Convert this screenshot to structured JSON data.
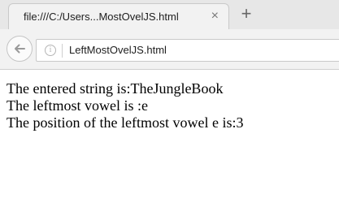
{
  "tab": {
    "title": "file:///C:/Users...MostOvelJS.html",
    "close_glyph": "×",
    "new_tab_glyph": "+"
  },
  "toolbar": {
    "info_glyph": "i",
    "url": "LeftMostOvelJS.html"
  },
  "content": {
    "lines": [
      "The entered string is:TheJungleBook",
      "The leftmost vowel is :e",
      "The position of the leftmost vowel e is:3"
    ]
  }
}
